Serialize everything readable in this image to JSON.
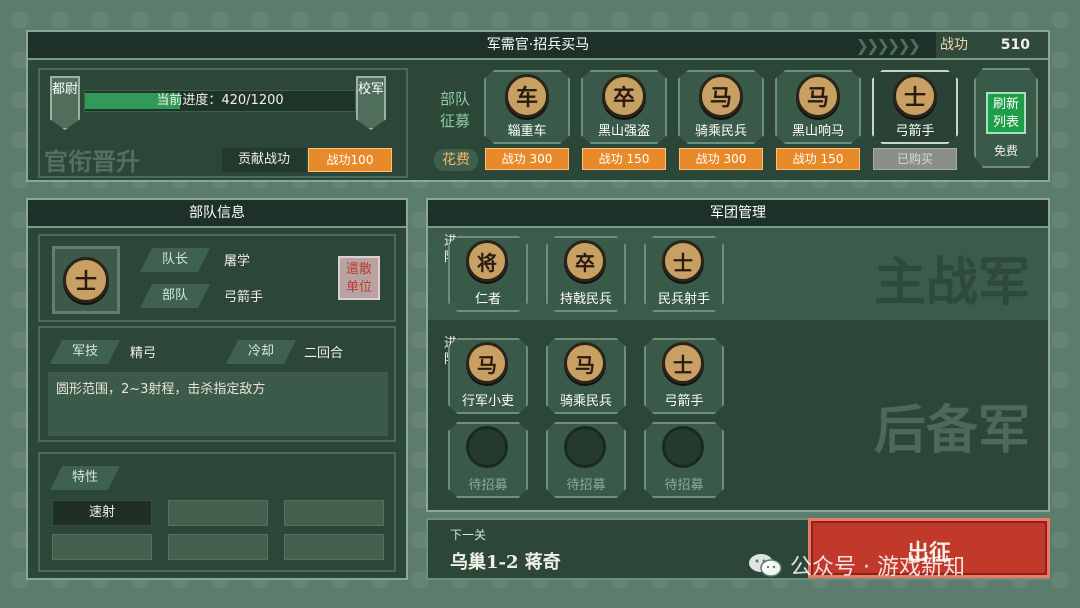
{
  "top": {
    "title": "军需官·招兵买马",
    "merit_label": "战功",
    "merit_value": "510",
    "rank_left": "都尉",
    "rank_right": "校军",
    "progress_text": "当前进度：420/1200",
    "progress": 0.35,
    "promotion_bg": "官衔晋升",
    "contribute_label": "贡献战功",
    "contribute_btn": "战功100",
    "recruit_label": "部队征募",
    "cost_label": "花费",
    "recruits": [
      {
        "glyph": "车",
        "name": "辎重车",
        "cost": "战功 300"
      },
      {
        "glyph": "卒",
        "name": "黑山强盗",
        "cost": "战功 150"
      },
      {
        "glyph": "马",
        "name": "骑乘民兵",
        "cost": "战功 300"
      },
      {
        "glyph": "马",
        "name": "黑山响马",
        "cost": "战功 150"
      },
      {
        "glyph": "士",
        "name": "弓箭手",
        "cost": "已购买"
      }
    ],
    "refresh_label": "刷新列表",
    "refresh_cost": "免费"
  },
  "unit": {
    "header": "部队信息",
    "glyph": "士",
    "captain_label": "队长",
    "captain_value": "屠学",
    "troop_label": "部队",
    "troop_value": "弓箭手",
    "disband": "遣散单位",
    "skill_label": "军技",
    "skill_value": "精弓",
    "cooldown_label": "冷却",
    "cooldown_value": "二回合",
    "skill_desc": "圆形范围，2~3射程，击杀指定敌方",
    "trait_label": "特性",
    "traits": [
      "速射"
    ]
  },
  "army": {
    "header": "军团管理",
    "main_label": "主战军",
    "reserve_label": "后备军",
    "advance_label": "进阶",
    "main": [
      {
        "glyph": "将",
        "name": "仁者"
      },
      {
        "glyph": "卒",
        "name": "持戟民兵"
      },
      {
        "glyph": "士",
        "name": "民兵射手"
      }
    ],
    "reserve": [
      {
        "glyph": "马",
        "name": "行军小吏"
      },
      {
        "glyph": "马",
        "name": "骑乘民兵"
      },
      {
        "glyph": "士",
        "name": "弓箭手"
      }
    ],
    "pending": [
      "待招募",
      "待招募",
      "待招募"
    ]
  },
  "next": {
    "label": "下一关",
    "stage": "乌巢1-2 蒋奇",
    "go": "出征"
  },
  "watermark": "公众号 · 游戏新知",
  "colors": {
    "accent": "#e88a2a",
    "panel": "#2c4638",
    "go": "#c0392b",
    "refresh": "#1f9e4a"
  }
}
